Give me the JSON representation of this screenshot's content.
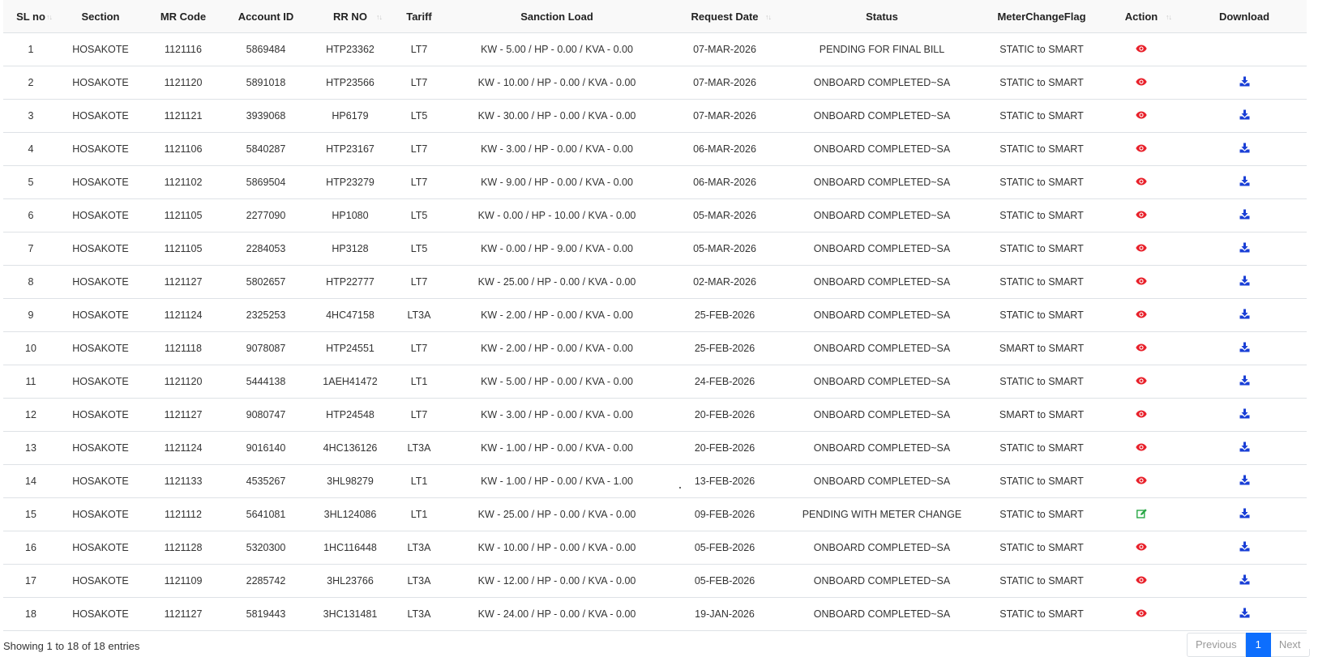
{
  "table": {
    "headers": [
      "SL no",
      "Section",
      "MR Code",
      "Account ID",
      "RR NO",
      "Tariff",
      "Sanction Load",
      "Request Date",
      "Status",
      "MeterChangeFlag",
      "Action",
      "Download"
    ],
    "rows": [
      [
        "1",
        "HOSAKOTE",
        "1121116",
        "5869484",
        "HTP23362",
        "LT7",
        "KW - 5.00 / HP - 0.00 / KVA - 0.00",
        "07-MAR-2026",
        "PENDING FOR FINAL BILL",
        "STATIC to SMART",
        "view",
        "none"
      ],
      [
        "2",
        "HOSAKOTE",
        "1121120",
        "5891018",
        "HTP23566",
        "LT7",
        "KW - 10.00 / HP - 0.00 / KVA - 0.00",
        "07-MAR-2026",
        "ONBOARD COMPLETED~SA",
        "STATIC to SMART",
        "view",
        "download"
      ],
      [
        "3",
        "HOSAKOTE",
        "1121121",
        "3939068",
        "HP6179",
        "LT5",
        "KW - 30.00 / HP - 0.00 / KVA - 0.00",
        "07-MAR-2026",
        "ONBOARD COMPLETED~SA",
        "STATIC to SMART",
        "view",
        "download"
      ],
      [
        "4",
        "HOSAKOTE",
        "1121106",
        "5840287",
        "HTP23167",
        "LT7",
        "KW - 3.00 / HP - 0.00 / KVA - 0.00",
        "06-MAR-2026",
        "ONBOARD COMPLETED~SA",
        "STATIC to SMART",
        "view",
        "download"
      ],
      [
        "5",
        "HOSAKOTE",
        "1121102",
        "5869504",
        "HTP23279",
        "LT7",
        "KW - 9.00 / HP - 0.00 / KVA - 0.00",
        "06-MAR-2026",
        "ONBOARD COMPLETED~SA",
        "STATIC to SMART",
        "view",
        "download"
      ],
      [
        "6",
        "HOSAKOTE",
        "1121105",
        "2277090",
        "HP1080",
        "LT5",
        "KW - 0.00 / HP - 10.00 / KVA - 0.00",
        "05-MAR-2026",
        "ONBOARD COMPLETED~SA",
        "STATIC to SMART",
        "view",
        "download"
      ],
      [
        "7",
        "HOSAKOTE",
        "1121105",
        "2284053",
        "HP3128",
        "LT5",
        "KW - 0.00 / HP - 9.00 / KVA - 0.00",
        "05-MAR-2026",
        "ONBOARD COMPLETED~SA",
        "STATIC to SMART",
        "view",
        "download"
      ],
      [
        "8",
        "HOSAKOTE",
        "1121127",
        "5802657",
        "HTP22777",
        "LT7",
        "KW - 25.00 / HP - 0.00 / KVA - 0.00",
        "02-MAR-2026",
        "ONBOARD COMPLETED~SA",
        "STATIC to SMART",
        "view",
        "download"
      ],
      [
        "9",
        "HOSAKOTE",
        "1121124",
        "2325253",
        "4HC47158",
        "LT3A",
        "KW - 2.00 / HP - 0.00 / KVA - 0.00",
        "25-FEB-2026",
        "ONBOARD COMPLETED~SA",
        "STATIC to SMART",
        "view",
        "download"
      ],
      [
        "10",
        "HOSAKOTE",
        "1121118",
        "9078087",
        "HTP24551",
        "LT7",
        "KW - 2.00 / HP - 0.00 / KVA - 0.00",
        "25-FEB-2026",
        "ONBOARD COMPLETED~SA",
        "SMART to SMART",
        "view",
        "download"
      ],
      [
        "11",
        "HOSAKOTE",
        "1121120",
        "5444138",
        "1AEH41472",
        "LT1",
        "KW - 5.00 / HP - 0.00 / KVA - 0.00",
        "24-FEB-2026",
        "ONBOARD COMPLETED~SA",
        "STATIC to SMART",
        "view",
        "download"
      ],
      [
        "12",
        "HOSAKOTE",
        "1121127",
        "9080747",
        "HTP24548",
        "LT7",
        "KW - 3.00 / HP - 0.00 / KVA - 0.00",
        "20-FEB-2026",
        "ONBOARD COMPLETED~SA",
        "SMART to SMART",
        "view",
        "download"
      ],
      [
        "13",
        "HOSAKOTE",
        "1121124",
        "9016140",
        "4HC136126",
        "LT3A",
        "KW - 1.00 / HP - 0.00 / KVA - 0.00",
        "20-FEB-2026",
        "ONBOARD COMPLETED~SA",
        "STATIC to SMART",
        "view",
        "download"
      ],
      [
        "14",
        "HOSAKOTE",
        "1121133",
        "4535267",
        "3HL98279",
        "LT1",
        "KW - 1.00 / HP - 0.00 / KVA - 1.00",
        "13-FEB-2026",
        "ONBOARD COMPLETED~SA",
        "STATIC to SMART",
        "view",
        "download"
      ],
      [
        "15",
        "HOSAKOTE",
        "1121112",
        "5641081",
        "3HL124086",
        "LT1",
        "KW - 25.00 / HP - 0.00 / KVA - 0.00",
        "09-FEB-2026",
        "PENDING WITH METER CHANGE",
        "STATIC to SMART",
        "edit",
        "download"
      ],
      [
        "16",
        "HOSAKOTE",
        "1121128",
        "5320300",
        "1HC116448",
        "LT3A",
        "KW - 10.00 / HP - 0.00 / KVA - 0.00",
        "05-FEB-2026",
        "ONBOARD COMPLETED~SA",
        "STATIC to SMART",
        "view",
        "download"
      ],
      [
        "17",
        "HOSAKOTE",
        "1121109",
        "2285742",
        "3HL23766",
        "LT3A",
        "KW - 12.00 / HP - 0.00 / KVA - 0.00",
        "05-FEB-2026",
        "ONBOARD COMPLETED~SA",
        "STATIC to SMART",
        "view",
        "download"
      ],
      [
        "18",
        "HOSAKOTE",
        "1121127",
        "5819443",
        "3HC131481",
        "LT3A",
        "KW - 24.00 / HP - 0.00 / KVA - 0.00",
        "19-JAN-2026",
        "ONBOARD COMPLETED~SA",
        "STATIC to SMART",
        "view",
        "download"
      ]
    ]
  },
  "icons": {
    "view": "eye-icon",
    "edit": "edit-icon",
    "download": "download-icon",
    "sort": "sort-icon"
  },
  "colors": {
    "view_icon": "#e8202a",
    "edit_icon": "#28a745",
    "download_icon": "#1a3fd6",
    "page_active": "#0d6efd"
  },
  "footer": {
    "info": "Showing 1 to 18 of 18 entries",
    "previous": "Previous",
    "current_page": "1",
    "next": "Next"
  }
}
